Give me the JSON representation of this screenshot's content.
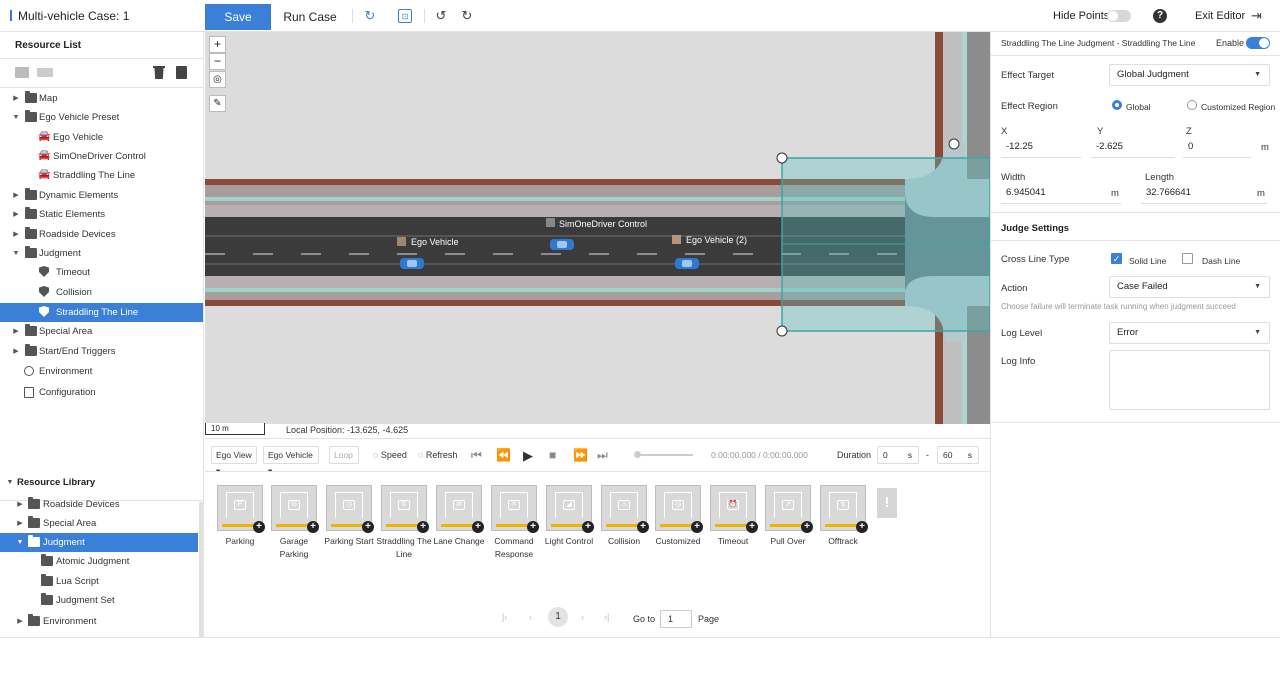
{
  "app": {
    "case_title": "Multi-vehicle Case: 1",
    "save_label": "Save",
    "run_label": "Run Case",
    "hide_points_label": "Hide Points",
    "exit_editor_label": "Exit Editor",
    "help_glyph": "?"
  },
  "resource_list": {
    "title": "Resource List",
    "items": [
      {
        "label": "Map"
      },
      {
        "label": "Ego Vehicle Preset"
      },
      {
        "label": "Ego Vehicle"
      },
      {
        "label": "SimOneDriver Control"
      },
      {
        "label": "Straddling The Line"
      },
      {
        "label": "Dynamic Elements"
      },
      {
        "label": "Static Elements"
      },
      {
        "label": "Roadside Devices"
      },
      {
        "label": "Judgment"
      },
      {
        "label": "Timeout"
      },
      {
        "label": "Collision"
      },
      {
        "label": "Straddling The Line"
      },
      {
        "label": "Special Area"
      },
      {
        "label": "Start/End Triggers"
      },
      {
        "label": "Environment"
      },
      {
        "label": "Configuration"
      }
    ]
  },
  "resource_library": {
    "title": "Resource Library",
    "items": [
      {
        "label": "Roadside Devices"
      },
      {
        "label": "Special Area"
      },
      {
        "label": "Judgment"
      },
      {
        "label": "Atomic Judgment"
      },
      {
        "label": "Lua Script"
      },
      {
        "label": "Judgment Set"
      },
      {
        "label": "Environment"
      }
    ]
  },
  "map": {
    "zoom_in": "+",
    "zoom_out": "−",
    "scale": "10 m",
    "local_position": "Local Position: -13.625, -4.625",
    "vehicles": [
      {
        "label": "Ego Vehicle"
      },
      {
        "label": "SimOneDriver Control"
      },
      {
        "label": "Ego Vehicle (2)"
      }
    ]
  },
  "playback": {
    "view": "Ego View",
    "vehicle": "Ego Vehicle",
    "loop": "Loop",
    "speed": "Speed",
    "refresh": "Refresh",
    "time": "0:00:00.000 / 0:00:00.000",
    "duration_label": "Duration",
    "duration_start": "0",
    "duration_end": "60",
    "unit_s": "s",
    "dash": "-"
  },
  "judgment_cards": [
    {
      "label": "Parking",
      "glyph": "P"
    },
    {
      "label": "Garage Parking",
      "glyph": "⊟"
    },
    {
      "label": "Parking Start",
      "glyph": "◷"
    },
    {
      "label": "Straddling The Line",
      "glyph": "⇅"
    },
    {
      "label": "Lane Change",
      "glyph": "⇄"
    },
    {
      "label": "Command Response",
      "glyph": "✕"
    },
    {
      "label": "Light Control",
      "glyph": "◢"
    },
    {
      "label": "Collision",
      "glyph": "⚠"
    },
    {
      "label": "Customized",
      "glyph": "◷"
    },
    {
      "label": "Timeout",
      "glyph": "⏰"
    },
    {
      "label": "Pull Over",
      "glyph": "↗"
    },
    {
      "label": "Offtrack",
      "glyph": "↯"
    }
  ],
  "pager": {
    "current": "1",
    "goto_label": "Go to",
    "goto_value": "1",
    "page_label": "Page"
  },
  "props": {
    "header": "Straddling The Line Judgment - Straddling The Line",
    "enable_label": "Enable",
    "effect_target_label": "Effect Target",
    "effect_target_value": "Global Judgment",
    "effect_region_label": "Effect Region",
    "region_global": "Global",
    "region_custom": "Customized Region",
    "x_label": "X",
    "x_value": "-12.25",
    "y_label": "Y",
    "y_value": "-2.625",
    "z_label": "Z",
    "z_value": "0",
    "unit_m": "m",
    "width_label": "Width",
    "width_value": "6.945041",
    "length_label": "Length",
    "length_value": "32.766641",
    "judge_settings": "Judge Settings",
    "cross_line_label": "Cross Line Type",
    "solid_line": "Solid Line",
    "dash_line": "Dash Line",
    "action_label": "Action",
    "action_value": "Case Failed",
    "action_hint": "Choose failure will terminate task running when judgment succeed",
    "log_level_label": "Log Level",
    "log_level_value": "Error",
    "log_info_label": "Log Info"
  },
  "colors": {
    "accent": "#3a7fd8",
    "road": "#3b3b3b",
    "region": "#5bbfbf"
  }
}
